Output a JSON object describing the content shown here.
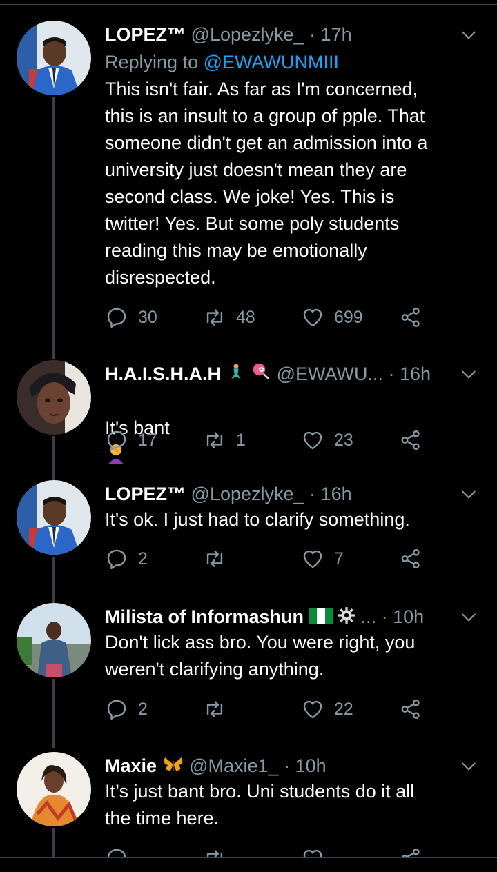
{
  "tweets": [
    {
      "name": "LOPEZ™",
      "handle": "@Lopezlyke_",
      "time": "· 17h",
      "replying_label": "Replying to",
      "replying_handle": "@EWAWUNMIII",
      "text": "This isn't fair. As far as I'm concerned,\nthis is an insult to a group of pple. That\nsomeone didn't get an admission into a\nuniversity just doesn't mean they are\nsecond class. We joke! Yes. This is\ntwitter! Yes. But some poly students\nreading this may be emotionally\ndisrespected.",
      "replies": "30",
      "retweets": "48",
      "likes": "699"
    },
    {
      "name": "H.A.I.S.H.A.H",
      "name_emoji": [
        "mermaid-emoji",
        "lollipop-emoji"
      ],
      "handle": "@EWAWU...",
      "time": "· 16h",
      "text": "It's bant",
      "text_emoji": "facepalm-emoji",
      "replies": "17",
      "retweets": "1",
      "likes": "23"
    },
    {
      "name": "LOPEZ™",
      "handle": "@Lopezlyke_",
      "time": "· 16h",
      "text": "It's ok. I just had to clarify something.",
      "replies": "2",
      "retweets": "",
      "likes": "7"
    },
    {
      "name": "Milista of Informashun",
      "name_emoji": [
        "nigeria-flag-emoji",
        "gear-emoji"
      ],
      "handle": "...",
      "time": "· 10h",
      "text": "Don't lick ass bro. You were right, you\nweren't clarifying anything.",
      "replies": "2",
      "retweets": "",
      "likes": "22"
    },
    {
      "name": "Maxie",
      "name_emoji": [
        "butterfly-emoji"
      ],
      "handle": "@Maxie1_",
      "time": "· 10h",
      "text": "It’s just bant bro. Uni students do it all\nthe time here.",
      "replies": "",
      "retweets": "",
      "likes": ""
    }
  ],
  "colors": {
    "background": "#000000",
    "secondary": "#8899a6",
    "link": "#1da1f2",
    "divider": "#38444d"
  }
}
